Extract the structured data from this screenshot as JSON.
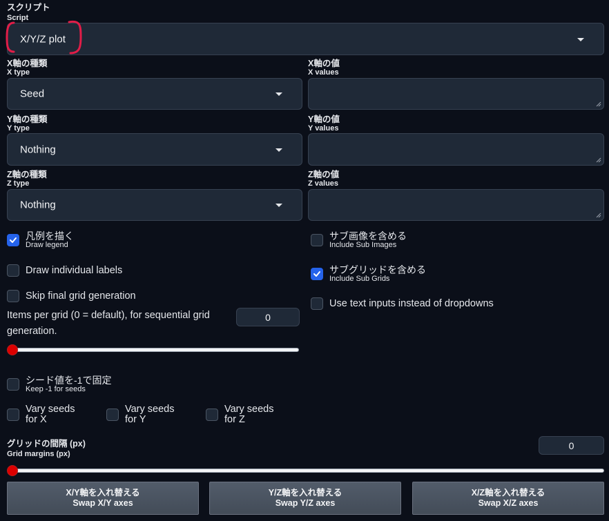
{
  "script": {
    "label": "スクリプト",
    "sublabel": "Script",
    "value": "X/Y/Z plot"
  },
  "x_type": {
    "label": "X軸の種類",
    "sublabel": "X type",
    "value": "Seed"
  },
  "x_values": {
    "label": "X軸の値",
    "sublabel": "X values",
    "value": ""
  },
  "y_type": {
    "label": "Y軸の種類",
    "sublabel": "Y type",
    "value": "Nothing"
  },
  "y_values": {
    "label": "Y軸の値",
    "sublabel": "Y values",
    "value": ""
  },
  "z_type": {
    "label": "Z軸の種類",
    "sublabel": "Z type",
    "value": "Nothing"
  },
  "z_values": {
    "label": "Z軸の値",
    "sublabel": "Z values",
    "value": ""
  },
  "draw_legend": {
    "label": "凡例を描く",
    "sublabel": "Draw legend",
    "checked": true
  },
  "include_sub_images": {
    "label": "サブ画像を含める",
    "sublabel": "Include Sub Images",
    "checked": false
  },
  "draw_individual_labels": {
    "label": "Draw individual labels",
    "checked": false
  },
  "include_sub_grids": {
    "label": "サブグリッドを含める",
    "sublabel": "Include Sub Grids",
    "checked": true
  },
  "skip_final_grid": {
    "label": "Skip final grid generation",
    "checked": false
  },
  "use_text_inputs": {
    "label": "Use text inputs instead of dropdowns",
    "checked": false
  },
  "items_per_grid": {
    "label_line1": "Items per grid (0 = default), for sequential grid",
    "label_line2": "generation.",
    "value": "0",
    "slider_value": 0
  },
  "keep_seed": {
    "label": "シード値を-1で固定",
    "sublabel": "Keep -1 for seeds",
    "checked": false
  },
  "vary_seeds_x": {
    "line1": "Vary seeds",
    "line2": "for X",
    "checked": false
  },
  "vary_seeds_y": {
    "line1": "Vary seeds",
    "line2": "for Y",
    "checked": false
  },
  "vary_seeds_z": {
    "line1": "Vary seeds",
    "line2": "for Z",
    "checked": false
  },
  "grid_margins": {
    "label": "グリッドの間隔 (px)",
    "sublabel": "Grid margins (px)",
    "value": "0",
    "slider_value": 0
  },
  "buttons": {
    "swap_xy": {
      "line1": "X/Y軸を入れ替える",
      "line2": "Swap X/Y axes"
    },
    "swap_yz": {
      "line1": "Y/Z軸を入れ替える",
      "line2": "Swap Y/Z axes"
    },
    "swap_xz": {
      "line1": "X/Z軸を入れ替える",
      "line2": "Swap X/Z axes"
    }
  },
  "colors": {
    "background": "#0b0f19",
    "input_bg": "#1f2937",
    "checkbox_checked": "#2563eb",
    "slider_thumb": "#dc0000",
    "annotation": "#e11d48"
  }
}
